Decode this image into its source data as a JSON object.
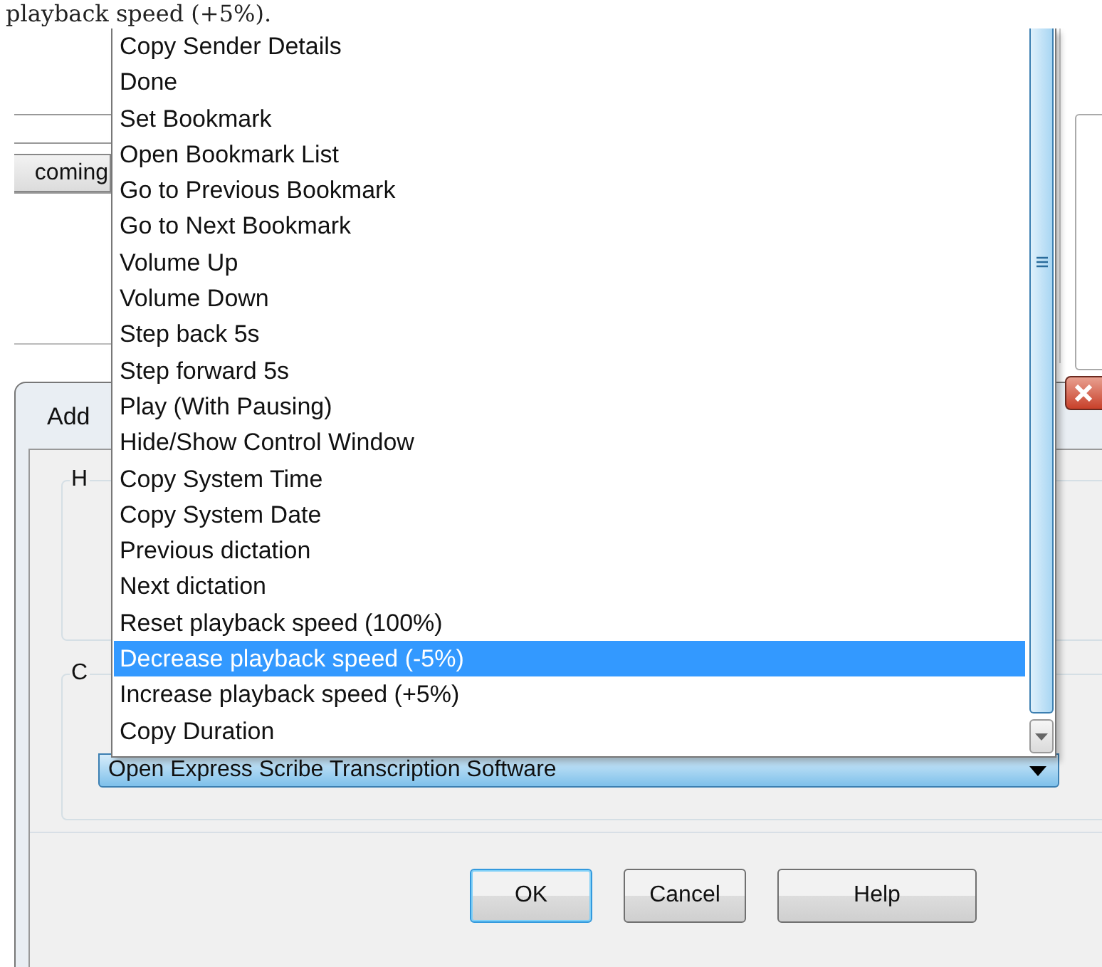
{
  "caption": "playback speed (+5%).",
  "background_window": {
    "button": "coming"
  },
  "dialog": {
    "title": "Add",
    "groups": [
      {
        "label": "H"
      },
      {
        "label": "C"
      }
    ],
    "combo": {
      "value": "Open Express Scribe Transcription Software",
      "expanded": true
    },
    "buttons": [
      {
        "label": "OK",
        "default": true
      },
      {
        "label": "Cancel",
        "default": false
      },
      {
        "label": "Help",
        "default": false
      }
    ]
  },
  "dropdown_list": {
    "items": [
      {
        "label": "Copy Sender Details",
        "selected": false
      },
      {
        "label": "Done",
        "selected": false
      },
      {
        "label": "Set Bookmark",
        "selected": false
      },
      {
        "label": "Open Bookmark List",
        "selected": false
      },
      {
        "label": "Go to Previous Bookmark",
        "selected": false
      },
      {
        "label": "Go to Next Bookmark",
        "selected": false
      },
      {
        "label": "Volume Up",
        "selected": false
      },
      {
        "label": "Volume Down",
        "selected": false
      },
      {
        "label": "Step back 5s",
        "selected": false
      },
      {
        "label": "Step forward 5s",
        "selected": false
      },
      {
        "label": "Play (With Pausing)",
        "selected": false
      },
      {
        "label": "Hide/Show Control Window",
        "selected": false
      },
      {
        "label": "Copy System Time",
        "selected": false
      },
      {
        "label": "Copy System Date",
        "selected": false
      },
      {
        "label": "Previous dictation",
        "selected": false
      },
      {
        "label": "Next dictation",
        "selected": false
      },
      {
        "label": "Reset playback speed (100%)",
        "selected": false
      },
      {
        "label": "Decrease playback speed (-5%)",
        "selected": true
      },
      {
        "label": "Increase playback speed (+5%)",
        "selected": false
      },
      {
        "label": "Copy Duration",
        "selected": false
      }
    ]
  }
}
